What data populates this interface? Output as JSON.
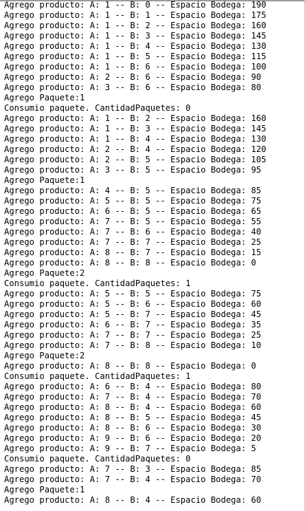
{
  "console": {
    "lines": [
      "Agrego producto: A: 1 -- B: 0 -- Espacio Bodega: 190",
      "Agrego producto: A: 1 -- B: 1 -- Espacio Bodega: 175",
      "Agrego producto: A: 1 -- B: 2 -- Espacio Bodega: 160",
      "Agrego producto: A: 1 -- B: 3 -- Espacio Bodega: 145",
      "Agrego producto: A: 1 -- B: 4 -- Espacio Bodega: 130",
      "Agrego producto: A: 1 -- B: 5 -- Espacio Bodega: 115",
      "Agrego producto: A: 1 -- B: 6 -- Espacio Bodega: 100",
      "Agrego producto: A: 2 -- B: 6 -- Espacio Bodega: 90",
      "Agrego producto: A: 3 -- B: 6 -- Espacio Bodega: 80",
      "Agrego Paquete:1",
      "Consumio paquete. CantidadPaquetes: 0",
      "Agrego producto: A: 1 -- B: 2 -- Espacio Bodega: 160",
      "Agrego producto: A: 1 -- B: 3 -- Espacio Bodega: 145",
      "Agrego producto: A: 1 -- B: 4 -- Espacio Bodega: 130",
      "Agrego producto: A: 2 -- B: 4 -- Espacio Bodega: 120",
      "Agrego producto: A: 2 -- B: 5 -- Espacio Bodega: 105",
      "Agrego producto: A: 3 -- B: 5 -- Espacio Bodega: 95",
      "Agrego Paquete:1",
      "Agrego producto: A: 4 -- B: 5 -- Espacio Bodega: 85",
      "Agrego producto: A: 5 -- B: 5 -- Espacio Bodega: 75",
      "Agrego producto: A: 6 -- B: 5 -- Espacio Bodega: 65",
      "Agrego producto: A: 7 -- B: 5 -- Espacio Bodega: 55",
      "Agrego producto: A: 7 -- B: 6 -- Espacio Bodega: 40",
      "Agrego producto: A: 7 -- B: 7 -- Espacio Bodega: 25",
      "Agrego producto: A: 8 -- B: 7 -- Espacio Bodega: 15",
      "Agrego producto: A: 8 -- B: 8 -- Espacio Bodega: 0",
      "Agrego Paquete:2",
      "Consumio paquete. CantidadPaquetes: 1",
      "Agrego producto: A: 5 -- B: 5 -- Espacio Bodega: 75",
      "Agrego producto: A: 5 -- B: 6 -- Espacio Bodega: 60",
      "Agrego producto: A: 5 -- B: 7 -- Espacio Bodega: 45",
      "Agrego producto: A: 6 -- B: 7 -- Espacio Bodega: 35",
      "Agrego producto: A: 7 -- B: 7 -- Espacio Bodega: 25",
      "Agrego producto: A: 7 -- B: 8 -- Espacio Bodega: 10",
      "Agrego Paquete:2",
      "Agrego producto: A: 8 -- B: 8 -- Espacio Bodega: 0",
      "Consumio paquete. CantidadPaquetes: 1",
      "Agrego producto: A: 6 -- B: 4 -- Espacio Bodega: 80",
      "Agrego producto: A: 7 -- B: 4 -- Espacio Bodega: 70",
      "Agrego producto: A: 8 -- B: 4 -- Espacio Bodega: 60",
      "Agrego producto: A: 8 -- B: 5 -- Espacio Bodega: 45",
      "Agrego producto: A: 8 -- B: 6 -- Espacio Bodega: 30",
      "Agrego producto: A: 9 -- B: 6 -- Espacio Bodega: 20",
      "Agrego producto: A: 9 -- B: 7 -- Espacio Bodega: 5",
      "Consumio paquete. CantidadPaquetes: 0",
      "Agrego producto: A: 7 -- B: 3 -- Espacio Bodega: 85",
      "Agrego producto: A: 7 -- B: 4 -- Espacio Bodega: 70",
      "Agrego Paquete:1",
      "Agrego producto: A: 8 -- B: 4 -- Espacio Bodega: 60"
    ]
  }
}
